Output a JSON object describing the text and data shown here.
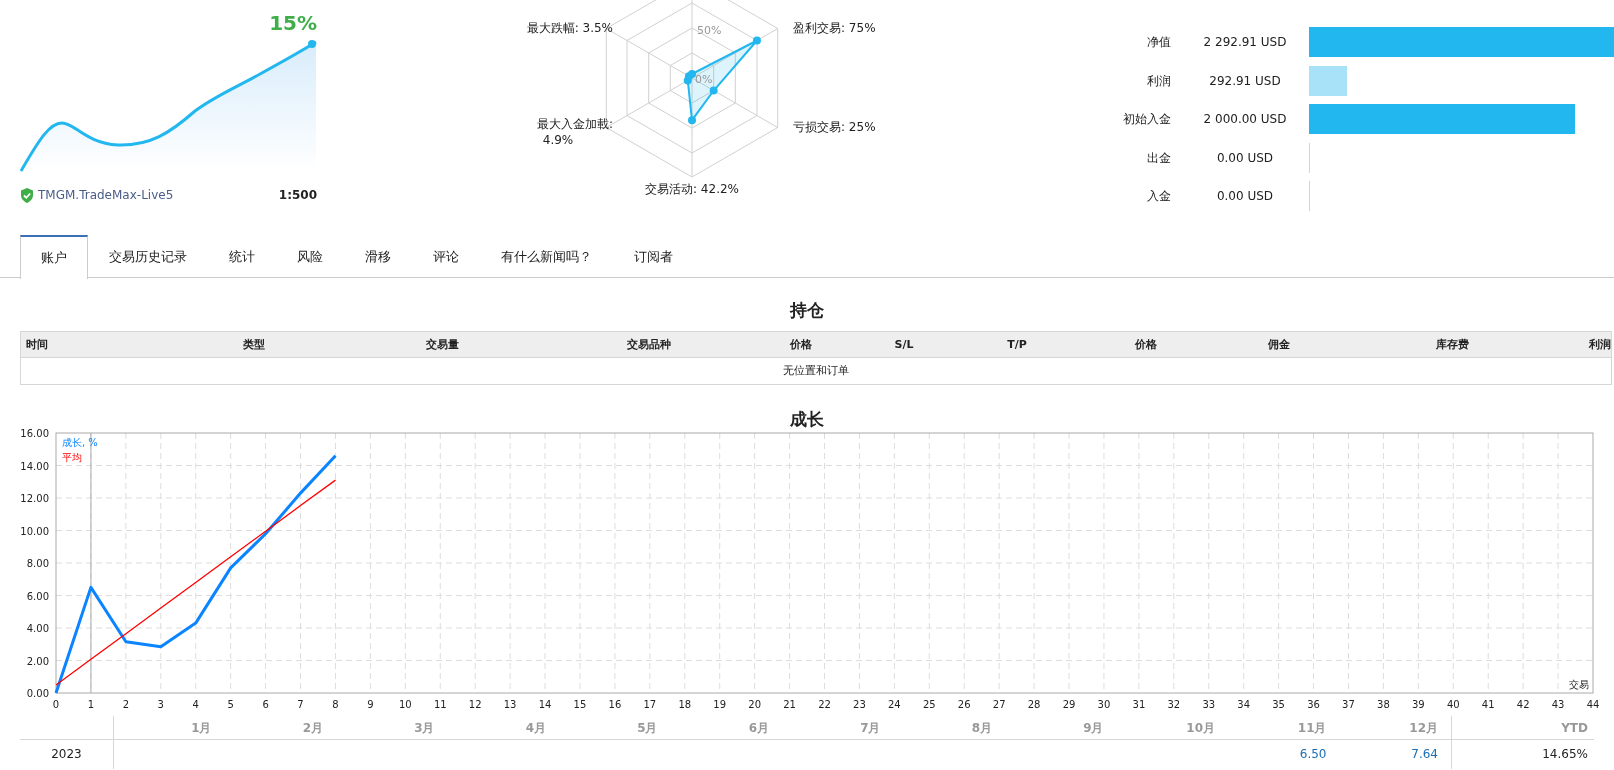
{
  "account": {
    "growth": "15%",
    "server": "TMGM.TradeMax-Live5",
    "leverage": "1:500"
  },
  "radar": {
    "labels": [
      {
        "kind": "left",
        "lines": [
          "最大跌幅: 3.5%"
        ]
      },
      {
        "kind": "right",
        "lines": [
          "盈利交易: 75%"
        ]
      },
      {
        "kind": "left",
        "lines": [
          "最大入金加載:",
          "4.9%"
        ]
      },
      {
        "kind": "right",
        "lines": [
          "亏损交易: 25%"
        ]
      },
      {
        "kind": "bottom",
        "lines": [
          "交易活动: 42.2%"
        ]
      }
    ],
    "ring_labels": [
      "50%",
      "0%"
    ]
  },
  "balances": [
    {
      "label": "净值",
      "value": "2 292.91 USD",
      "level": 1,
      "color": "#22b7ee"
    },
    {
      "label": "利润",
      "value": "292.91 USD",
      "level": 0.125,
      "color": "#a8e2f8"
    },
    {
      "label": "初始入金",
      "value": "2 000.00 USD",
      "level": 0.872,
      "color": "#22b7ee"
    },
    {
      "label": "出金",
      "value": "0.00 USD",
      "level": 0
    },
    {
      "label": "入金",
      "value": "0.00 USD",
      "level": 0
    }
  ],
  "tabs": [
    {
      "label": "账户",
      "selected": true
    },
    {
      "label": "交易历史记录",
      "selected": false
    },
    {
      "label": "统计",
      "selected": false
    },
    {
      "label": "风险",
      "selected": false
    },
    {
      "label": "滑移",
      "selected": false
    },
    {
      "label": "评论",
      "selected": false
    },
    {
      "label": "有什么新闻吗？",
      "selected": false
    },
    {
      "label": "订阅者",
      "selected": false
    }
  ],
  "positions": {
    "title": "持仓",
    "columns": [
      "时间",
      "类型",
      "交易量",
      "交易品种",
      "价格",
      "S/L",
      "T/P",
      "价格",
      "佣金",
      "库存费",
      "利润"
    ],
    "empty_message": "无位置和订单"
  },
  "growth": {
    "title": "成长",
    "x_unit": "交易",
    "chart_data": {
      "type": "line",
      "grid": true,
      "x": [
        0,
        1,
        2,
        3,
        4,
        5,
        6,
        7,
        8
      ],
      "series": [
        {
          "name": "成长, %",
          "color": "#0a84ff",
          "values": [
            0,
            6.5,
            3.15,
            2.85,
            4.3,
            7.7,
            9.8,
            12.3,
            14.6
          ]
        },
        {
          "name": "平均",
          "color": "#ff0000",
          "values": [
            0.5,
            2.08,
            3.65,
            5.23,
            6.8,
            8.38,
            9.95,
            11.53,
            13.1
          ]
        }
      ],
      "xlim": [
        0,
        44
      ],
      "ylim": [
        0,
        16
      ],
      "xticks": [
        0,
        1,
        2,
        3,
        4,
        5,
        6,
        7,
        8,
        9,
        10,
        11,
        12,
        13,
        14,
        15,
        16,
        17,
        18,
        19,
        20,
        21,
        22,
        23,
        24,
        25,
        26,
        27,
        28,
        29,
        30,
        31,
        32,
        33,
        34,
        35,
        36,
        37,
        38,
        39,
        40,
        41,
        42,
        43,
        44
      ],
      "yticks": [
        {
          "value": 0,
          "label": "0.00"
        },
        {
          "value": 2,
          "label": "2.00"
        },
        {
          "value": 4,
          "label": "4.00"
        },
        {
          "value": 6,
          "label": "6.00"
        },
        {
          "value": 8,
          "label": "8.00"
        },
        {
          "value": 10,
          "label": "10.00"
        },
        {
          "value": 12,
          "label": "12.00"
        },
        {
          "value": 14,
          "label": "14.00"
        },
        {
          "value": 16,
          "label": "16.00"
        }
      ]
    }
  },
  "monthly": {
    "months": [
      "1月",
      "2月",
      "3月",
      "4月",
      "5月",
      "6月",
      "7月",
      "8月",
      "9月",
      "10月",
      "11月",
      "12月"
    ],
    "ytd_label": "YTD",
    "rows": [
      {
        "year": "2023",
        "cells": [
          {},
          {},
          {},
          {},
          {},
          {},
          {},
          {},
          {},
          {},
          {
            "value": "6.50"
          },
          {
            "value": "7.64"
          }
        ],
        "ytd": "14.65%"
      }
    ]
  }
}
